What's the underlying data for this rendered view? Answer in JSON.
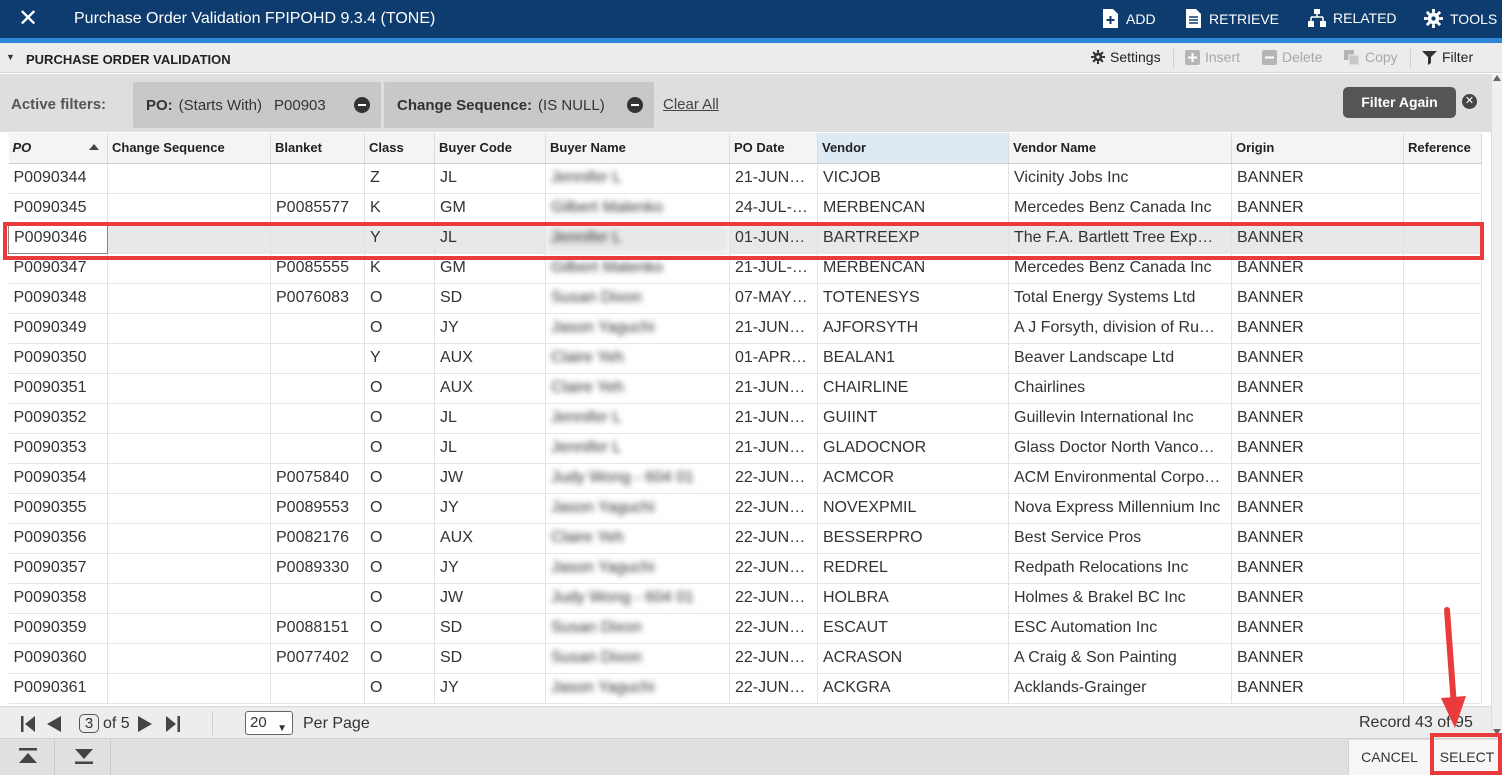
{
  "app": {
    "title": "Purchase Order Validation FPIPOHD 9.3.4 (TONE)",
    "close_label": "✕",
    "actions": [
      {
        "label": "ADD",
        "icon": "add-document-icon"
      },
      {
        "label": "RETRIEVE",
        "icon": "retrieve-document-icon"
      },
      {
        "label": "RELATED",
        "icon": "hierarchy-icon"
      },
      {
        "label": "TOOLS",
        "icon": "gear-icon"
      }
    ]
  },
  "section": {
    "title": "PURCHASE ORDER VALIDATION",
    "settings": "Settings",
    "insert": "Insert",
    "delete": "Delete",
    "copy": "Copy",
    "filter": "Filter"
  },
  "filters": {
    "label": "Active filters:",
    "chips": [
      {
        "field": "PO:",
        "operator": "(Starts With)",
        "value": "P00903"
      },
      {
        "field": "Change Sequence:",
        "operator": "(IS NULL)",
        "value": ""
      }
    ],
    "clear_all": "Clear All",
    "filter_again": "Filter Again"
  },
  "table": {
    "columns": [
      "PO",
      "Change Sequence",
      "Blanket",
      "Class",
      "Buyer Code",
      "Buyer Name",
      "PO Date",
      "Vendor",
      "Vendor Name",
      "Origin",
      "Reference"
    ],
    "rows": [
      [
        "P0090344",
        "",
        "",
        "Z",
        "JL",
        "Jennifer L",
        "21-JUN…",
        "VICJOB",
        "Vicinity Jobs Inc",
        "BANNER",
        ""
      ],
      [
        "P0090345",
        "",
        "P0085577",
        "K",
        "GM",
        "Gilbert Malenko",
        "24-JUL-…",
        "MERBENCAN",
        "Mercedes Benz Canada Inc",
        "BANNER",
        ""
      ],
      [
        "P0090346",
        "",
        "",
        "Y",
        "JL",
        "Jennifer L",
        "01-JUN…",
        "BARTREEXP",
        "The F.A. Bartlett Tree Exp…",
        "BANNER",
        ""
      ],
      [
        "P0090347",
        "",
        "P0085555",
        "K",
        "GM",
        "Gilbert Malenko",
        "21-JUL-…",
        "MERBENCAN",
        "Mercedes Benz Canada Inc",
        "BANNER",
        ""
      ],
      [
        "P0090348",
        "",
        "P0076083",
        "O",
        "SD",
        "Susan Dixon",
        "07-MAY…",
        "TOTENESYS",
        "Total Energy Systems Ltd",
        "BANNER",
        ""
      ],
      [
        "P0090349",
        "",
        "",
        "O",
        "JY",
        "Jason Yaguchi",
        "21-JUN…",
        "AJFORSYTH",
        "A J Forsyth, division of Ru…",
        "BANNER",
        ""
      ],
      [
        "P0090350",
        "",
        "",
        "Y",
        "AUX",
        "Claire Yeh",
        "01-APR…",
        "BEALAN1",
        "Beaver Landscape Ltd",
        "BANNER",
        ""
      ],
      [
        "P0090351",
        "",
        "",
        "O",
        "AUX",
        "Claire Yeh",
        "21-JUN…",
        "CHAIRLINE",
        "Chairlines",
        "BANNER",
        ""
      ],
      [
        "P0090352",
        "",
        "",
        "O",
        "JL",
        "Jennifer L",
        "21-JUN…",
        "GUIINT",
        "Guillevin International Inc",
        "BANNER",
        ""
      ],
      [
        "P0090353",
        "",
        "",
        "O",
        "JL",
        "Jennifer L",
        "21-JUN…",
        "GLADOCNOR",
        "Glass Doctor North Vanco…",
        "BANNER",
        ""
      ],
      [
        "P0090354",
        "",
        "P0075840",
        "O",
        "JW",
        "Judy Wong - 604 01",
        "22-JUN…",
        "ACMCOR",
        "ACM Environmental Corpo…",
        "BANNER",
        ""
      ],
      [
        "P0090355",
        "",
        "P0089553",
        "O",
        "JY",
        "Jason Yaguchi",
        "22-JUN…",
        "NOVEXPMIL",
        "Nova Express Millennium Inc",
        "BANNER",
        ""
      ],
      [
        "P0090356",
        "",
        "P0082176",
        "O",
        "AUX",
        "Claire Yeh",
        "22-JUN…",
        "BESSERPRO",
        "Best Service Pros",
        "BANNER",
        ""
      ],
      [
        "P0090357",
        "",
        "P0089330",
        "O",
        "JY",
        "Jason Yaguchi",
        "22-JUN…",
        "REDREL",
        "Redpath Relocations Inc",
        "BANNER",
        ""
      ],
      [
        "P0090358",
        "",
        "",
        "O",
        "JW",
        "Judy Wong - 604 01",
        "22-JUN…",
        "HOLBRA",
        "Holmes & Brakel BC Inc",
        "BANNER",
        ""
      ],
      [
        "P0090359",
        "",
        "P0088151",
        "O",
        "SD",
        "Susan Dixon",
        "22-JUN…",
        "ESCAUT",
        "ESC Automation Inc",
        "BANNER",
        ""
      ],
      [
        "P0090360",
        "",
        "P0077402",
        "O",
        "SD",
        "Susan Dixon",
        "22-JUN…",
        "ACRASON",
        "A Craig & Son Painting",
        "BANNER",
        ""
      ],
      [
        "P0090361",
        "",
        "",
        "O",
        "JY",
        "Jason Yaguchi",
        "22-JUN…",
        "ACKGRA",
        "Acklands-Grainger",
        "BANNER",
        ""
      ]
    ],
    "selected_row": 2
  },
  "pager": {
    "current_page": "3",
    "of_pages": "of 5",
    "per_page_value": "20",
    "per_page_label": "Per Page",
    "record": "Record 43 of 95"
  },
  "footer": {
    "cancel": "CANCEL",
    "select": "SELECT"
  },
  "colors": {
    "titlebar": "#0f3c6e",
    "accent": "#2e86d9",
    "annotation": "#e93b3b"
  }
}
